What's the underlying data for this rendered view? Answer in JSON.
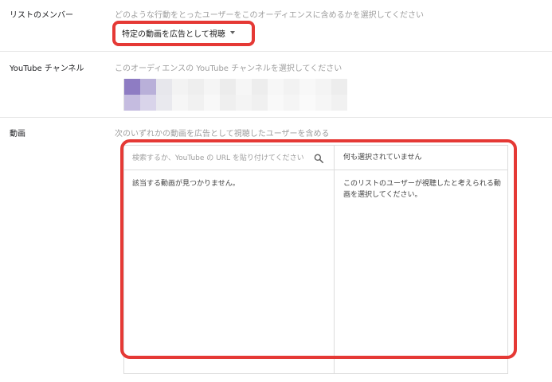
{
  "members": {
    "label": "リストのメンバー",
    "hint": "どのような行動をとったユーザーをこのオーディエンスに含めるかを選択してください",
    "dropdown_value": "特定の動画を広告として視聴"
  },
  "channel": {
    "label": "YouTube チャンネル",
    "hint": "このオーディエンスの YouTube チャンネルを選択してください"
  },
  "videos": {
    "label": "動画",
    "hint": "次のいずれかの動画を広告として視聴したユーザーを含める",
    "search_placeholder": "検索するか、YouTube の URL を貼り付けてください",
    "no_results": "該当する動画が見つかりません。",
    "selected_header": "何も選択されていません",
    "selected_hint": "このリストのユーザーが視聴したと考えられる動画を選択してください。"
  },
  "colors": {
    "highlight": "#e53935",
    "channel_avatar_primary": "#8e7cc3",
    "channel_avatar_secondary": "#c5bce0"
  },
  "icons": {
    "search": "search-icon",
    "dropdown": "chevron-down-icon"
  }
}
